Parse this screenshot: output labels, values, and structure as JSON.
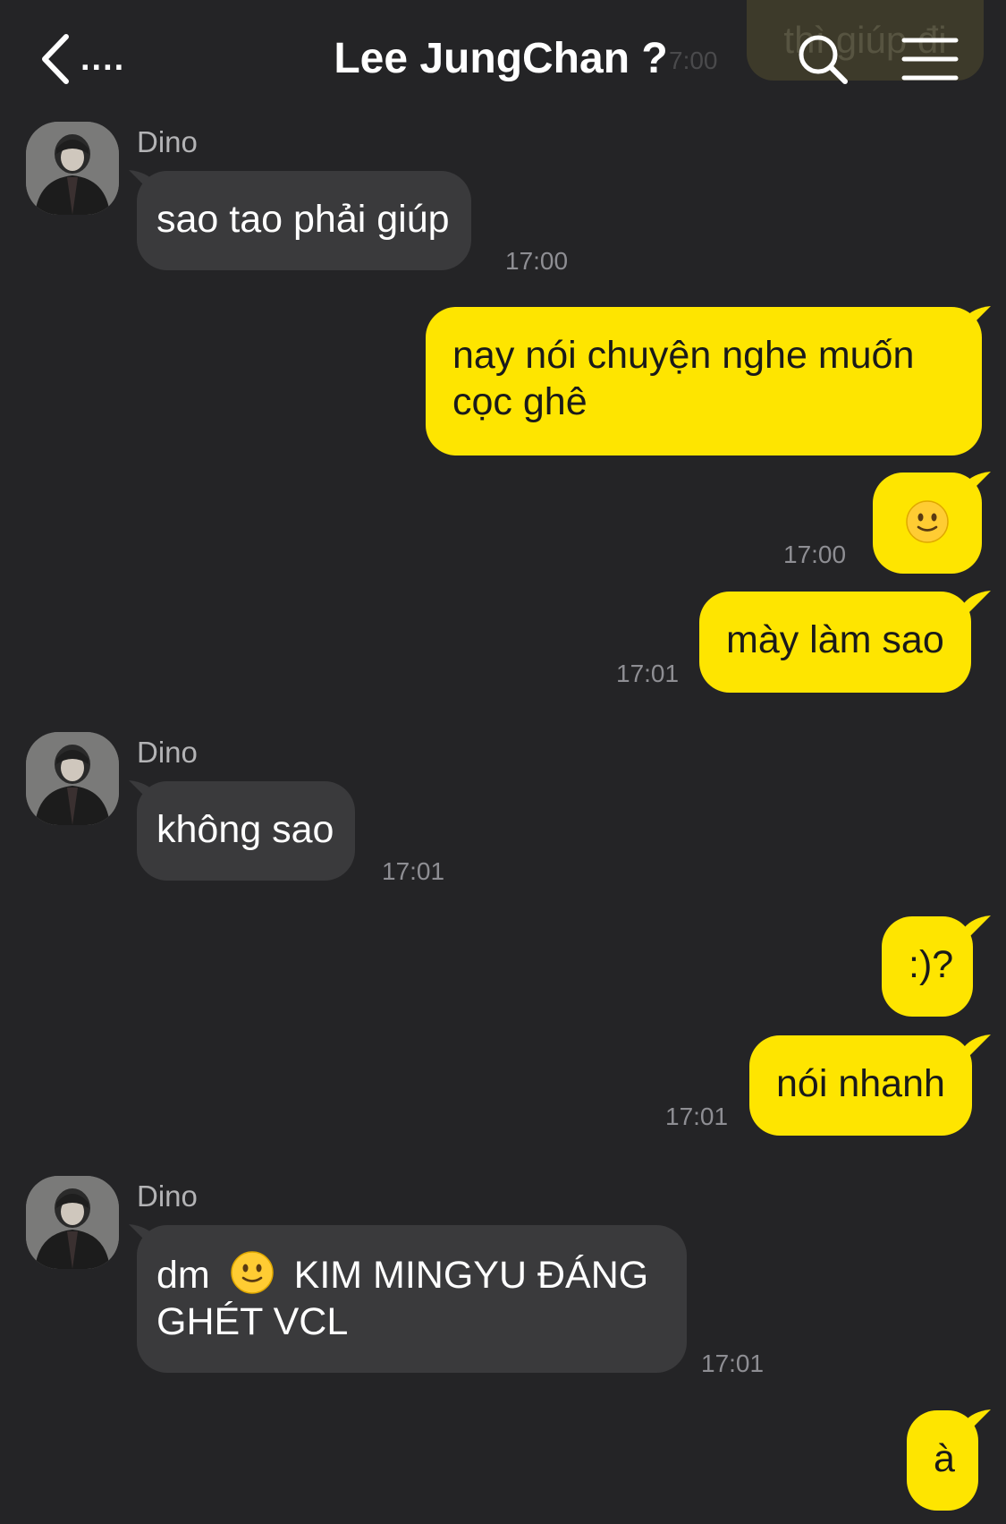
{
  "header": {
    "back_label": "....",
    "title": "Lee JungChan ?",
    "icons": [
      "chevron-left-icon",
      "search-icon",
      "menu-icon"
    ]
  },
  "ghost": {
    "text": "thì giúp đi",
    "time": "7:00"
  },
  "messages": [
    {
      "side": "in",
      "sender": "Dino",
      "text": "sao tao phải giúp",
      "time": "17:00"
    },
    {
      "side": "out",
      "text": "nay nói chuyện nghe muốn cọc ghê",
      "line1": "nay nói chuyện nghe muốn",
      "line2": "cọc ghê"
    },
    {
      "side": "out",
      "text": "🙂",
      "time": "17:00"
    },
    {
      "side": "out",
      "text": "mày làm sao",
      "time": "17:01"
    },
    {
      "side": "in",
      "sender": "Dino",
      "text": "không sao",
      "time": "17:01"
    },
    {
      "side": "out",
      "text": ":)?"
    },
    {
      "side": "out",
      "text": "nói nhanh",
      "time": "17:01"
    },
    {
      "side": "in",
      "sender": "Dino",
      "text_prefix": "dm",
      "text_emoji": "🙂",
      "text_line1_rest": "KIM MINGYU ĐÁNG",
      "text_line2": "GHÉT VCL",
      "time": "17:01"
    },
    {
      "side": "out",
      "text": "à"
    }
  ],
  "colors": {
    "background": "#242426",
    "incoming_bubble": "#3a3a3c",
    "outgoing_bubble": "#fee500",
    "timestamp": "#8e8e93",
    "sender_name": "#b3b3b5"
  }
}
